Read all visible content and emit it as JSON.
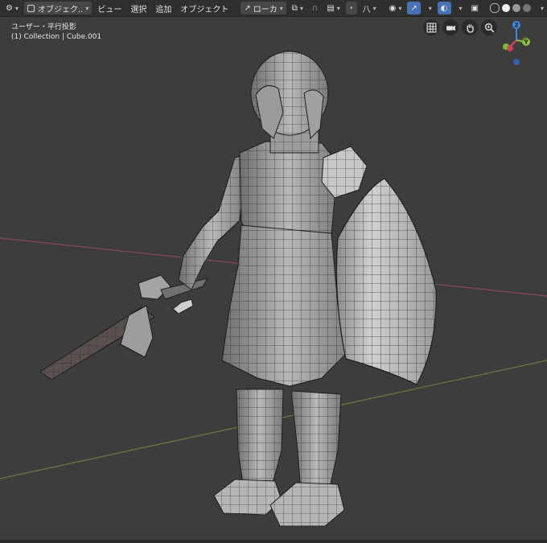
{
  "header": {
    "mode_label": "オブジェク..",
    "view_menu": "ビュー",
    "select_menu": "選択",
    "add_menu": "追加",
    "object_menu": "オブジェクト",
    "transform_orientation": "ローカ",
    "proportional_symbol": "八"
  },
  "viewport": {
    "view_name": "ユーザー・平行投影",
    "collection_info": "(1) Collection | Cube.001"
  },
  "gizmo": {
    "z_label": "Z",
    "y_label": "Y",
    "x_color": "#e0415c",
    "y_color": "#8bc43f",
    "z_color": "#3d8ae3"
  },
  "axes": {
    "x_axis_color": "#8a4a55",
    "y_axis_color": "#6f7a3d"
  },
  "icons": [
    "view-icon",
    "select-mode-icon",
    "transform-pivot-icon",
    "snap-icon",
    "proportional-edit-icon",
    "visibility-icon",
    "gizmo-icon",
    "overlay-icon",
    "xray-icon",
    "shading-solid-icon",
    "grid-icon",
    "camera-icon",
    "hand-icon",
    "zoom-icon"
  ]
}
